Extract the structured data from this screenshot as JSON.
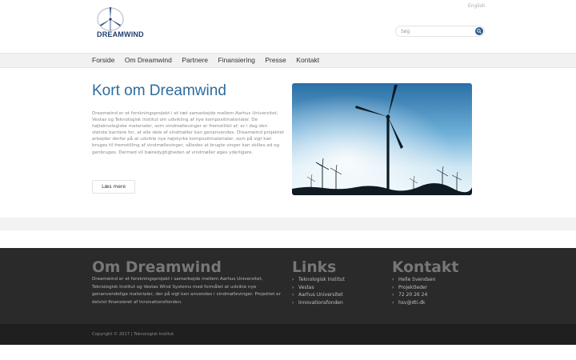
{
  "header": {
    "logo_text": "DREAMWIND",
    "lang_link": "English",
    "search_placeholder": "Søg",
    "search_icon": "search-icon"
  },
  "nav": {
    "items": [
      {
        "label": "Forside"
      },
      {
        "label": "Om Dreamwind"
      },
      {
        "label": "Partnere"
      },
      {
        "label": "Finansiering"
      },
      {
        "label": "Presse"
      },
      {
        "label": "Kontakt"
      }
    ]
  },
  "main": {
    "title": "Kort om Dreamwind",
    "text": "Dreamwind er et forskningsprojekt i et tæt samarbejde mellem Aarhus Universitet, Vestas og Teknologisk Institut om udvikling af nye kompositmaterialer. De højteknologiske materialer, som vindmøllevinger er fremstillet af, er i dag den største barriere for, at alle dele af vindmøller kan genanvendes. Dreamwind projektet arbejder derfor på at udvikle nye højstyrke kompositmaterialer, som på sigt kan bruges til fremstilling af vindmøllevinger, således at brugte vinger kan skilles ad og genbruges. Dermed vil bæredygtigheden af vindmøller øges yderligere.",
    "read_more": "Læs mere"
  },
  "footer": {
    "about_title": "Om Dreamwind",
    "about_text": "Dreamwind er et forskningsprojekt i samarbejde mellem Aarhus Universitet, Teknologisk Institut og Vestas Wind Systems med formålet at udvikle nye genanvendelige materialer, der på sigt kan anvendes i vindmøllevinger. Projektet er delvist finansieret af Innovationsfonden.",
    "links_title": "Links",
    "links": [
      "Teknologisk Institut",
      "Vestas",
      "Aarhus Universitet",
      "Innovationsfonden"
    ],
    "contact_title": "Kontakt",
    "contact": [
      "Helle Svendsen",
      "Projektleder",
      "72 20 26 24",
      "hsv@dti.dk"
    ],
    "copyright": "Copyright © 2017 | Teknologisk Institut"
  },
  "colors": {
    "brand_blue": "#2c6c9f",
    "logo_navy": "#1f3f6e",
    "footer_bg": "#2a2a2a",
    "bottom_bg": "#1f1f1f"
  }
}
